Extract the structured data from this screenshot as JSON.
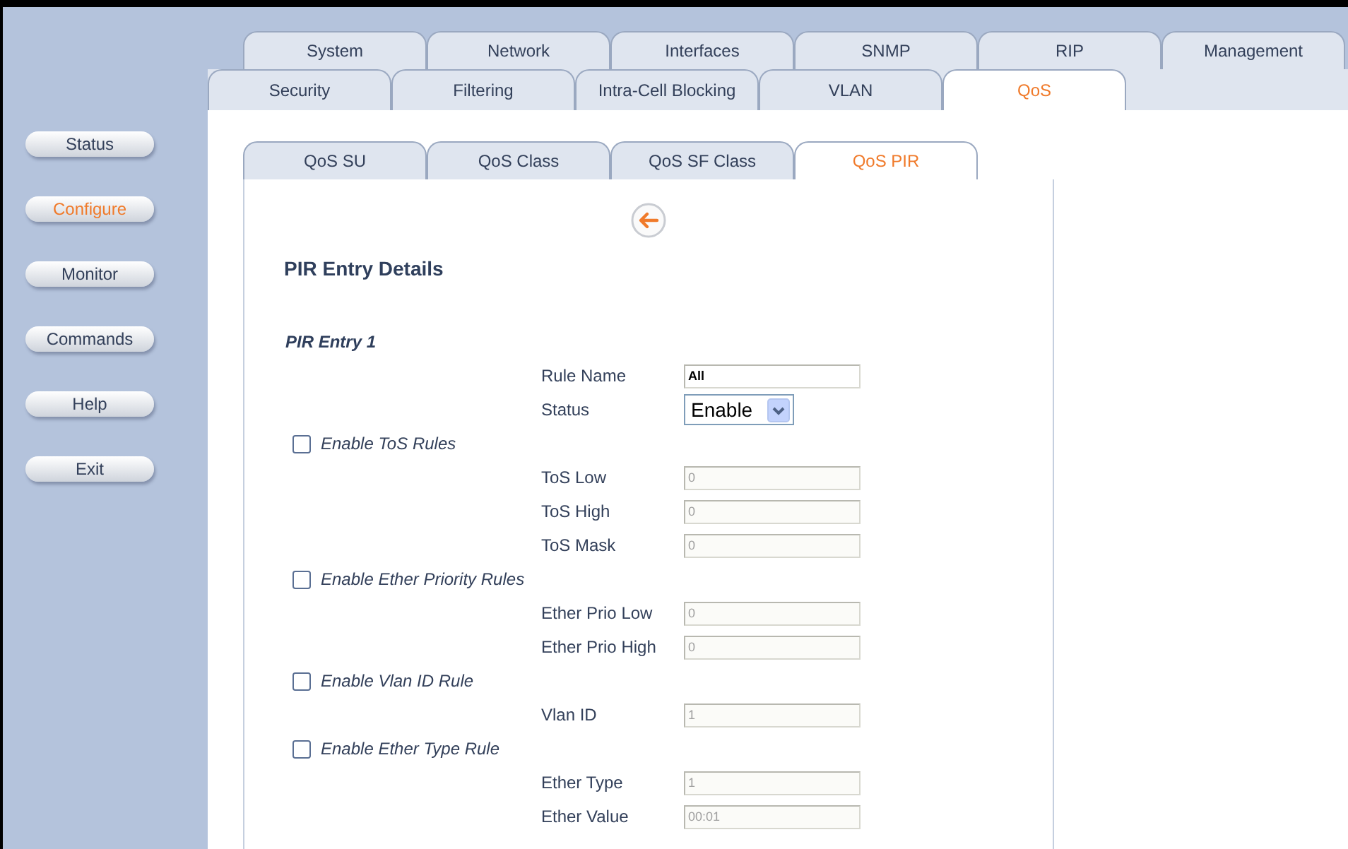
{
  "main_tabs": [
    {
      "label": "System",
      "selected": false
    },
    {
      "label": "Network",
      "selected": false
    },
    {
      "label": "Interfaces",
      "selected": false
    },
    {
      "label": "SNMP",
      "selected": false
    },
    {
      "label": "RIP",
      "selected": false
    },
    {
      "label": "Management",
      "selected": false
    }
  ],
  "sub_tabs": [
    {
      "label": "Security",
      "selected": false
    },
    {
      "label": "Filtering",
      "selected": false
    },
    {
      "label": "Intra-Cell Blocking",
      "selected": false
    },
    {
      "label": "VLAN",
      "selected": false
    },
    {
      "label": "QoS",
      "selected": true
    }
  ],
  "sidebar": {
    "items": [
      {
        "label": "Status",
        "selected": false
      },
      {
        "label": "Configure",
        "selected": true
      },
      {
        "label": "Monitor",
        "selected": false
      },
      {
        "label": "Commands",
        "selected": false
      },
      {
        "label": "Help",
        "selected": false
      },
      {
        "label": "Exit",
        "selected": false
      }
    ]
  },
  "qos_tabs": [
    {
      "label": "QoS SU",
      "selected": false
    },
    {
      "label": "QoS Class",
      "selected": false
    },
    {
      "label": "QoS SF Class",
      "selected": false
    },
    {
      "label": "QoS PIR",
      "selected": true
    }
  ],
  "panel": {
    "heading": "PIR Entry Details",
    "entry_title": "PIR Entry 1",
    "rows": [
      {
        "kind": "text",
        "label": "Rule Name",
        "value": "All",
        "disabled": false
      },
      {
        "kind": "select",
        "label": "Status",
        "value": "Enable"
      },
      {
        "kind": "checkbox",
        "label": "Enable ToS Rules",
        "checked": false
      },
      {
        "kind": "text",
        "label": "ToS Low",
        "value": "0",
        "disabled": true
      },
      {
        "kind": "text",
        "label": "ToS High",
        "value": "0",
        "disabled": true
      },
      {
        "kind": "text",
        "label": "ToS Mask",
        "value": "0",
        "disabled": true
      },
      {
        "kind": "checkbox",
        "label": "Enable Ether Priority Rules",
        "checked": false
      },
      {
        "kind": "text",
        "label": "Ether Prio Low",
        "value": "0",
        "disabled": true
      },
      {
        "kind": "text",
        "label": "Ether Prio High",
        "value": "0",
        "disabled": true
      },
      {
        "kind": "checkbox",
        "label": "Enable Vlan ID Rule",
        "checked": false
      },
      {
        "kind": "text",
        "label": "Vlan ID",
        "value": "1",
        "disabled": true
      },
      {
        "kind": "checkbox",
        "label": "Enable Ether Type Rule",
        "checked": false
      },
      {
        "kind": "text",
        "label": "Ether Type",
        "value": "1",
        "disabled": true
      },
      {
        "kind": "text",
        "label": "Ether Value",
        "value": "00:01",
        "disabled": true
      }
    ]
  }
}
